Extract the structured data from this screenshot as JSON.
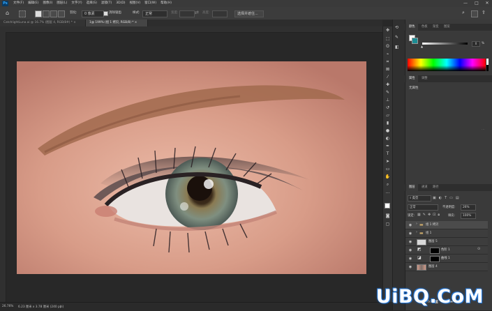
{
  "menubar": {
    "logo": "Ps",
    "menus": [
      "文件(F)",
      "编辑(E)",
      "图像(I)",
      "图层(L)",
      "文字(Y)",
      "选择(S)",
      "滤镜(T)",
      "3D(D)",
      "视图(V)",
      "窗口(W)",
      "帮助(H)"
    ],
    "minimize": "—",
    "maximize": "□",
    "close": "✕"
  },
  "options": {
    "feather_label": "羽化:",
    "feather_value": "0 像素",
    "antialias_label": "消除锯齿",
    "style_label": "样式:",
    "style_value": "正常",
    "width_label": "宽度:",
    "height_label": "高度:",
    "select_mask_button": "选择并遮住..."
  },
  "tabs": [
    {
      "label": "CatchlightLuna.ai @ 16.7% (图层 4, RGB/8#) *  ×",
      "active": false
    },
    {
      "label": "1@ 199% (组 1 拷贝, RGB/8) *  ×",
      "active": true
    }
  ],
  "status": {
    "zoom": "26.76%",
    "doc_info": "6.23 厘米 x 3.78 厘米 (240 ppi)"
  },
  "color_panel": {
    "tabs": [
      "颜色",
      "色板",
      "渐变",
      "图案"
    ],
    "slider_value": "0",
    "percent": "%"
  },
  "properties_panel": {
    "tabs": [
      "属性",
      "调整"
    ],
    "empty_text": "无属性"
  },
  "layers_panel": {
    "tabs": [
      "图层",
      "通道",
      "路径"
    ],
    "filter_type": "类型",
    "blend_mode": "正常",
    "opacity_label": "不透明度:",
    "opacity_value": "26%",
    "lock_label": "锁定:",
    "fill_label": "填充:",
    "fill_value": "100%",
    "layers": [
      {
        "name": "组 1 拷贝",
        "type": "group",
        "selected": true
      },
      {
        "name": "组 1",
        "type": "group",
        "selected": false
      },
      {
        "name": "图层 5",
        "type": "layer",
        "selected": false
      },
      {
        "name": "色阶 1",
        "type": "adjust",
        "selected": false
      },
      {
        "name": "曲线 1",
        "type": "adjust",
        "selected": false
      },
      {
        "name": "图层 4",
        "type": "photo",
        "selected": false
      }
    ]
  },
  "watermark": "UiBQ.CoM",
  "colors": {
    "accent": "#31a8ff",
    "workspace": "#282828",
    "panel": "#3a3a3a"
  }
}
